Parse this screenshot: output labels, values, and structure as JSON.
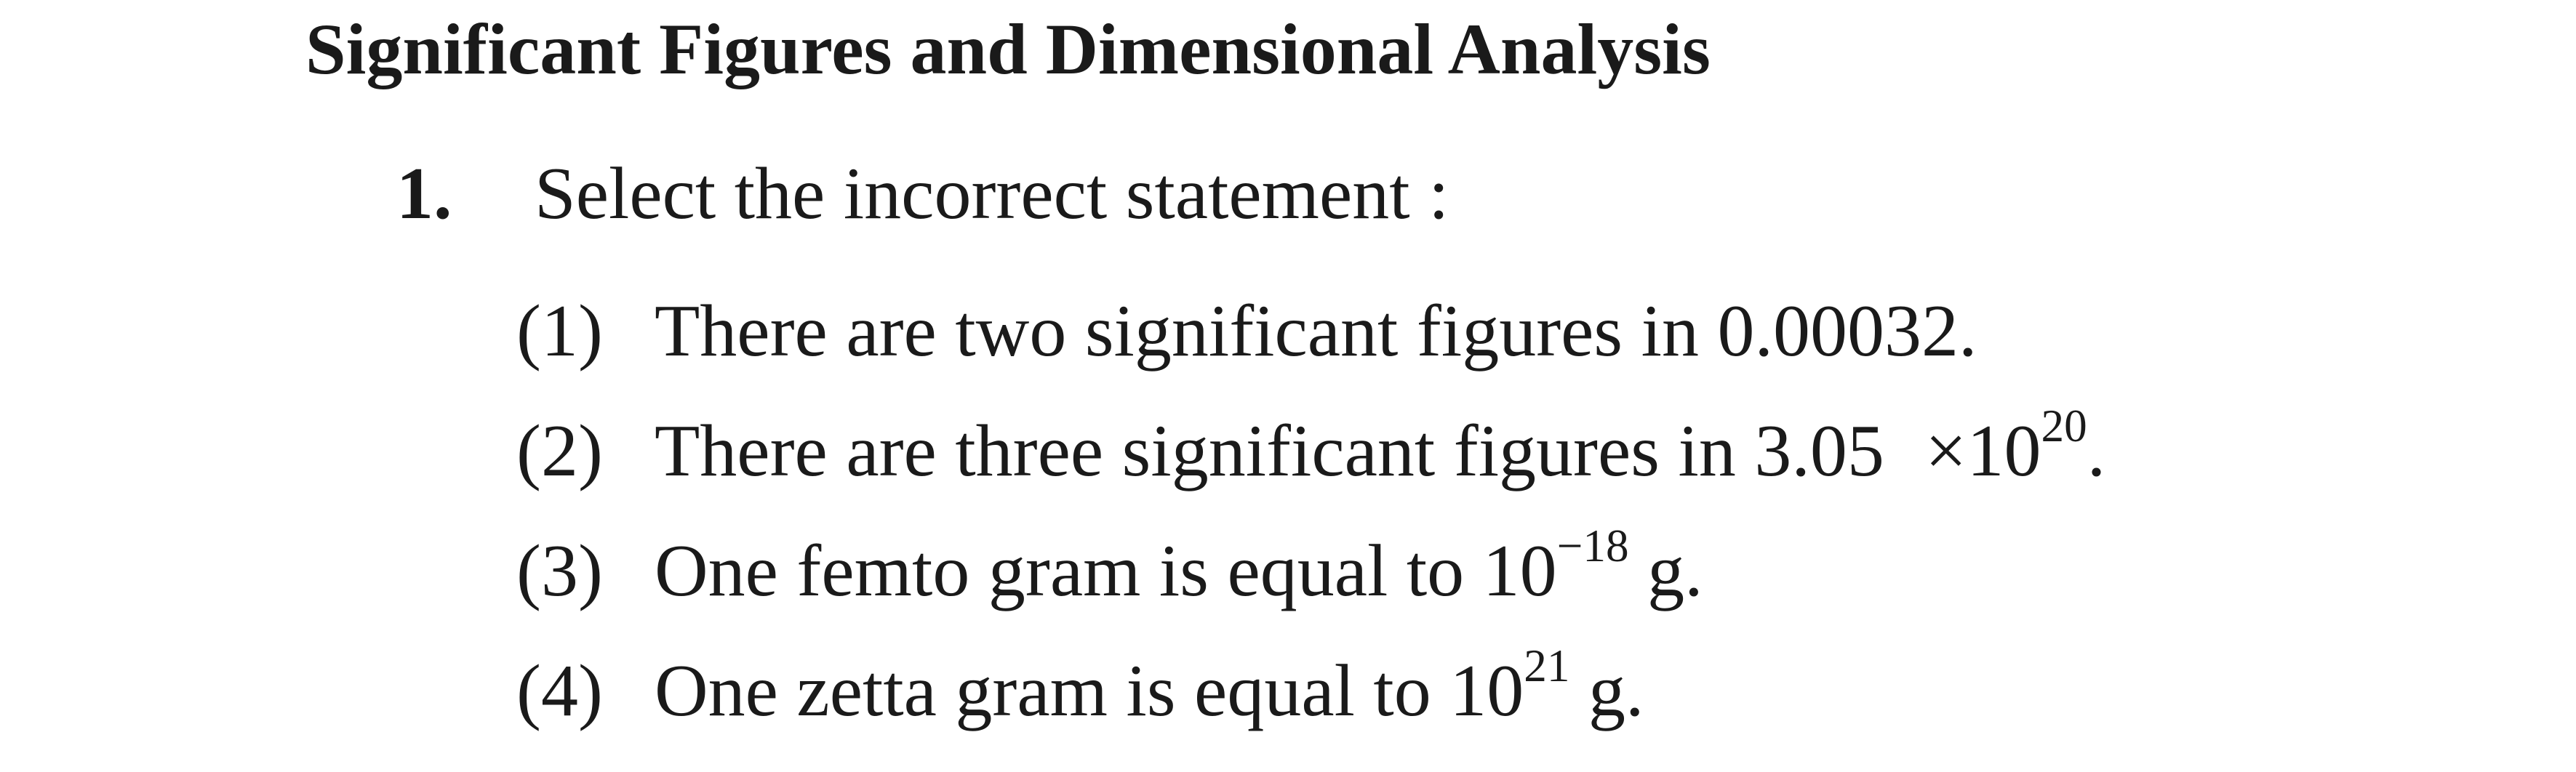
{
  "heading": "Significant Figures and Dimensional Analysis",
  "question": {
    "number": "1.",
    "prompt": "Select the incorrect statement :"
  },
  "options": [
    {
      "label": "(1)",
      "text": "There are two significant figures in 0.00032."
    },
    {
      "label": "(2)",
      "text_before": "There are three significant figures in 3.05",
      "times": "×",
      "base": "10",
      "exponent": "20",
      "text_after": "."
    },
    {
      "label": "(3)",
      "text_before": "One femto gram is equal to 10",
      "exponent": "−18",
      "text_after": " g."
    },
    {
      "label": "(4)",
      "text_before": "One zetta gram is equal to 10",
      "exponent": "21",
      "text_after": " g."
    }
  ]
}
